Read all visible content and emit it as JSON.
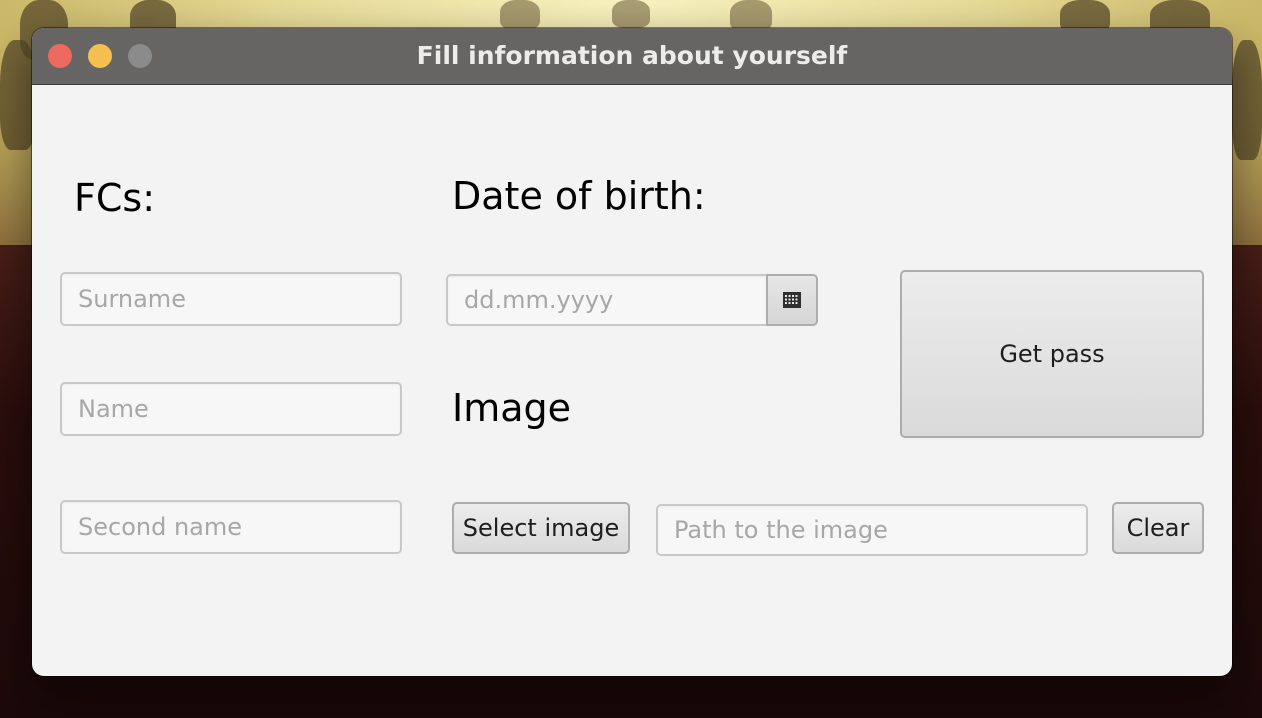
{
  "window": {
    "title": "Fill information about yourself"
  },
  "labels": {
    "fcs": "FCs:",
    "date_of_birth": "Date of birth:",
    "image": "Image"
  },
  "fields": {
    "surname": {
      "value": "",
      "placeholder": "Surname"
    },
    "name": {
      "value": "",
      "placeholder": "Name"
    },
    "second_name": {
      "value": "",
      "placeholder": "Second name"
    },
    "date_of_birth": {
      "value": "",
      "placeholder": "dd.mm.yyyy"
    },
    "image_path": {
      "value": "",
      "placeholder": "Path to the image"
    }
  },
  "buttons": {
    "get_pass": "Get pass",
    "select_image": "Select image",
    "clear": "Clear"
  },
  "icons": {
    "calendar": "calendar-icon",
    "close": "close-icon",
    "minimize": "minimize-icon",
    "zoom": "zoom-icon"
  },
  "colors": {
    "titlebar": "#666564",
    "window_background": "#f3f3f3",
    "traffic_close": "#ec6a5e",
    "traffic_minimize": "#f4bf4f",
    "traffic_zoom": "#8b8b8b"
  }
}
